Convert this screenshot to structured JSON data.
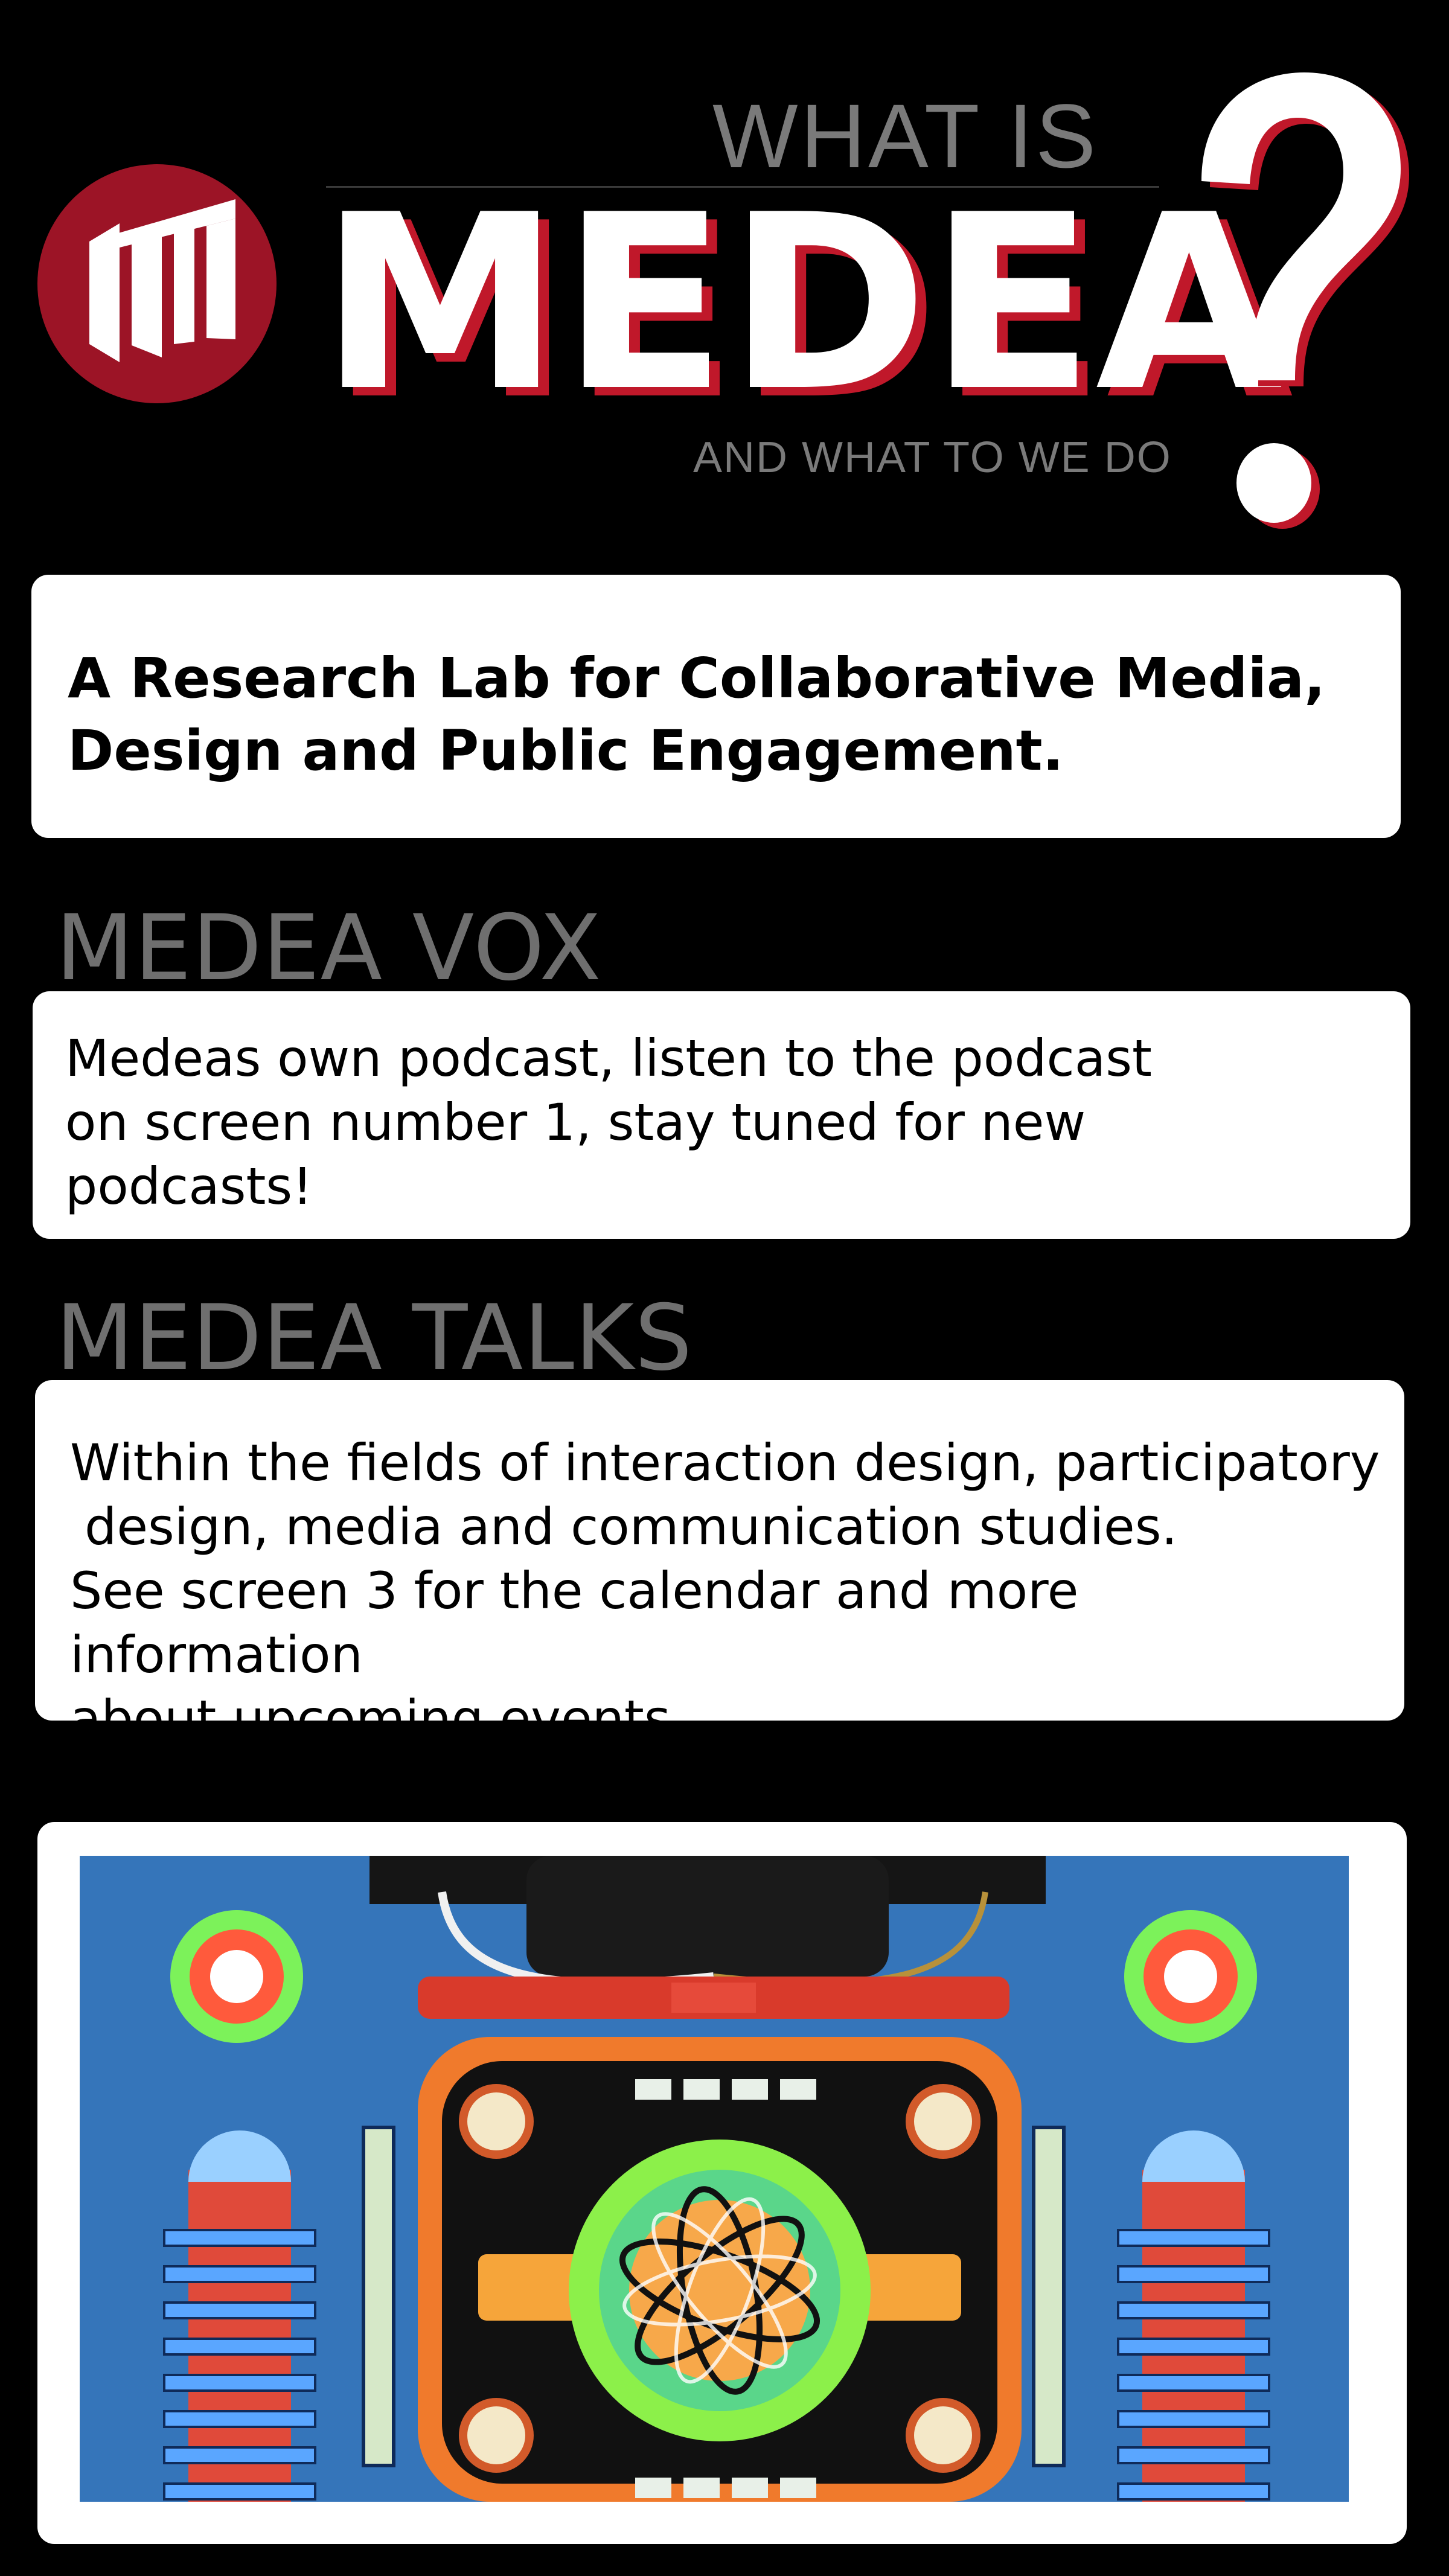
{
  "header": {
    "what_is": "WHAT IS",
    "title": "MEDEA",
    "question_mark": "?",
    "subtitle": "AND WHAT TO WE DO",
    "logo_icon": "medea-logo-icon",
    "accent_color": "#c0182a"
  },
  "intro": {
    "text": "A Research Lab for Collaborative Media, Design and Public Engagement."
  },
  "vox": {
    "heading": "MEDEA VOX",
    "text": "Medeas own podcast, listen to the podcast on screen number 1, stay tuned for new podcasts!"
  },
  "talks": {
    "heading": "MEDEA TALKS",
    "line1": "Within the fields of interaction design, participatory",
    "line2": "design, media and communication studies.",
    "line3": "See screen 3 for the calendar and more information",
    "line4": "about upcoming events."
  },
  "poster": {
    "icon": "retro-robot-toy-image"
  }
}
